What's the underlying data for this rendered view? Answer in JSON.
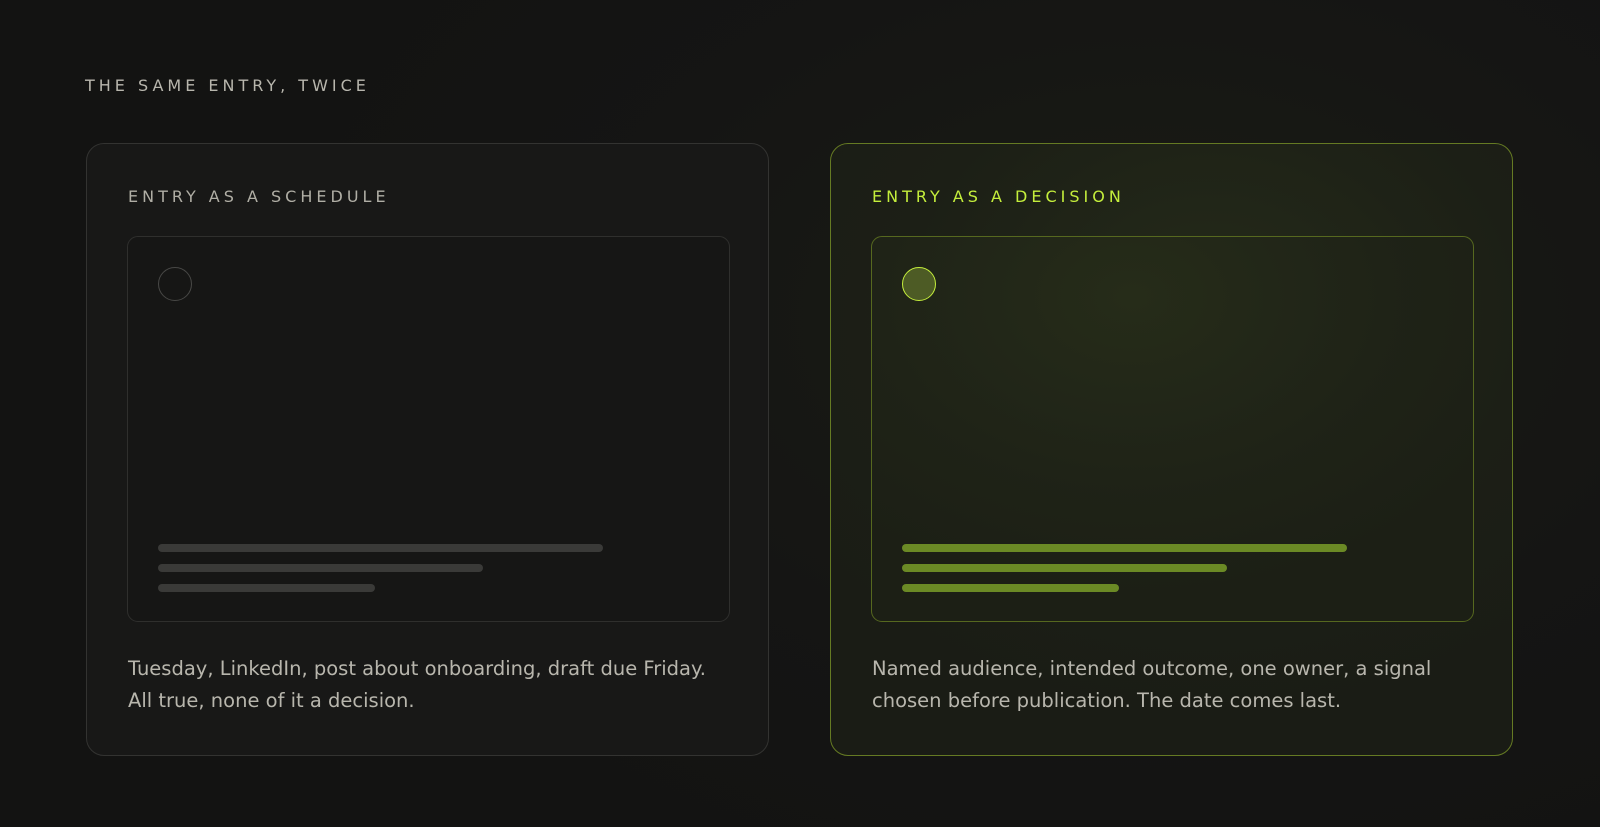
{
  "header": {
    "eyebrow": "THE SAME ENTRY, TWICE"
  },
  "cards": [
    {
      "title": "ENTRY AS A SCHEDULE",
      "caption": "Tuesday, LinkedIn, post about onboarding, draft due Friday. All true, none of it a decision.",
      "state": "neutral"
    },
    {
      "title": "ENTRY AS A DECISION",
      "caption": "Named audience, intended outcome, one owner, a signal chosen before publication. The date comes last.",
      "state": "highlighted"
    }
  ],
  "colors": {
    "background": "#141413",
    "accent": "#c4ee3c",
    "accent_muted": "#6b8a25",
    "neutral_bar": "#3a3a38",
    "text_muted": "#b8b6ad"
  }
}
